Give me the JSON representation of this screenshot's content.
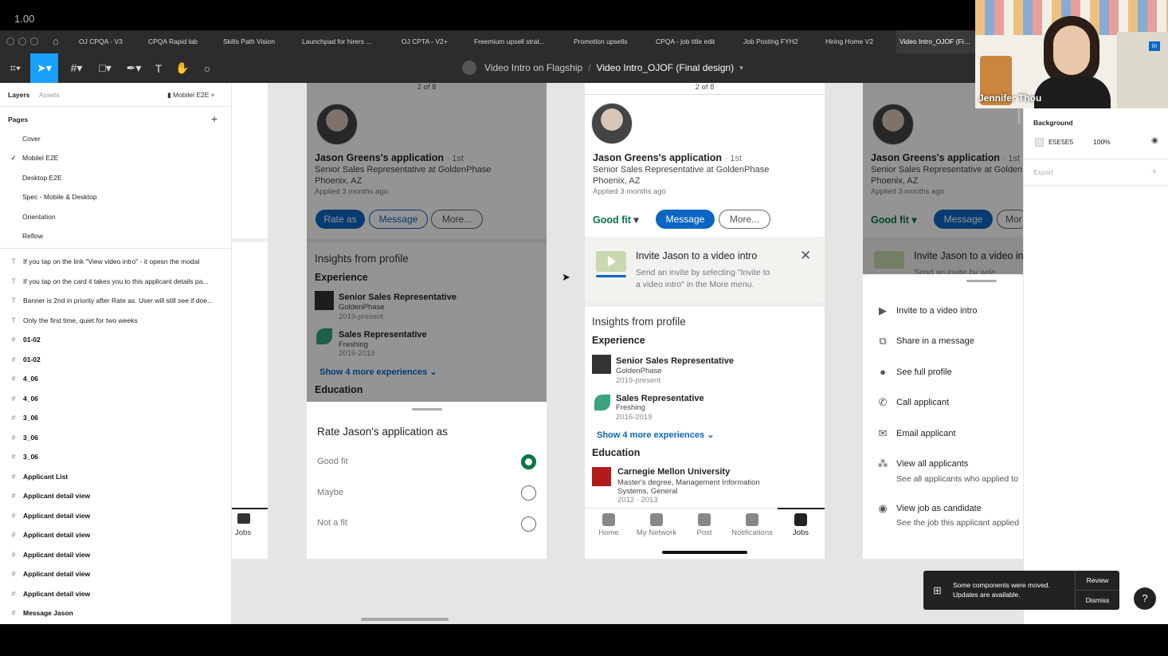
{
  "zoom": "1.00",
  "tabs": [
    "OJ CPQA - V3",
    "CPQA Rapid lab",
    "Skills Path Vision",
    "Launchpad for hirers ...",
    "OJ CPTA - V2+",
    "Freemium upsell strat...",
    "Promotion upsells",
    "CPQA - job title edit",
    "Job Posting FYH2",
    "Hiring Home V2",
    "Video Intro_OJOF (Fin..."
  ],
  "breadcrumb": {
    "project": "Video Intro on Flagship",
    "separator": "/",
    "file": "Video Intro_OJOF (Final design)"
  },
  "layers_panel": {
    "tab_layers": "Layers",
    "tab_assets": "Assets",
    "page_selector": "Mobilel E2E",
    "pages_label": "Pages",
    "pages": [
      "Cover",
      "Mobilel E2E",
      "Desktop E2E",
      "Spec - Mobile & Desktop",
      "Orientation",
      "Reflow"
    ],
    "layers": [
      {
        "type": "text",
        "label": "If you tap on the link \"View video intro\" - it opesn the modal"
      },
      {
        "type": "text",
        "label": "If you tap on the card it takes you to this applicant details pa..."
      },
      {
        "type": "text",
        "label": "Banner is 2nd in priority after Rate as. User will still see if doe..."
      },
      {
        "type": "text",
        "label": "Only the first time, quiet for two weeks"
      },
      {
        "type": "frame",
        "label": "01-02"
      },
      {
        "type": "frame",
        "label": "01-02"
      },
      {
        "type": "frame",
        "label": "4_06"
      },
      {
        "type": "frame",
        "label": "4_06"
      },
      {
        "type": "frame",
        "label": "3_06"
      },
      {
        "type": "frame",
        "label": "3_06"
      },
      {
        "type": "frame",
        "label": "3_06"
      },
      {
        "type": "frame",
        "label": "Applicant List"
      },
      {
        "type": "frame",
        "label": "Applicant detail view"
      },
      {
        "type": "frame",
        "label": "Applicant detail view"
      },
      {
        "type": "frame",
        "label": "Applicant detail view"
      },
      {
        "type": "frame",
        "label": "Applicant detail view"
      },
      {
        "type": "frame",
        "label": "Applicant detail view"
      },
      {
        "type": "frame",
        "label": "Applicant detail view"
      },
      {
        "type": "frame",
        "label": "Message Jason"
      }
    ]
  },
  "right_panel": {
    "background_label": "Background",
    "bg_hex": "E5E5E5",
    "bg_opacity": "100%",
    "export_label": "Export"
  },
  "video": {
    "name": "Jennifer Thou"
  },
  "applicant": {
    "counter": "2 of 8",
    "name": "Jason Greens's application",
    "degree": "· 1st",
    "headline": "Senior Sales Representative at GoldenPhase",
    "location": "Phoenix, AZ",
    "applied": "Applied 3 months ago",
    "rate_as": "Rate as",
    "good_fit": "Good fit",
    "message": "Message",
    "more": "More...",
    "more_short": "Mor",
    "insights": "Insights from profile",
    "experience": "Experience",
    "exp1_title": "Senior Sales Representative",
    "exp1_company": "GoldenPhase",
    "exp1_dates": "2019-present",
    "exp2_title": "Sales Representative",
    "exp2_company": "Freshing",
    "exp2_dates": "2016-2019",
    "show_more": "Show 4 more experiences",
    "education": "Education",
    "edu_school": "Carnegie Mellon University",
    "edu_degree_1": "Master's degree, Management Information",
    "edu_degree_2": "Systems, General",
    "edu_dates": "2012 - 2013"
  },
  "invite_banner": {
    "title": "Invite Jason to a video intro",
    "title_short": "Invite Jason to a video in",
    "body_1": "Send an invite by selecting \"Invite to",
    "body_2": "a video intro\" in the More menu.",
    "body_short": "Send an invite by sele"
  },
  "rate_sheet": {
    "title": "Rate Jason's application as",
    "options": [
      {
        "label": "Good fit",
        "selected": true
      },
      {
        "label": "Maybe",
        "selected": false
      },
      {
        "label": "Not a fit",
        "selected": false
      }
    ]
  },
  "more_menu": {
    "items": [
      {
        "icon": "video-icon",
        "label": "Invite to a video intro",
        "sub": ""
      },
      {
        "icon": "share-icon",
        "label": "Share in a message",
        "sub": ""
      },
      {
        "icon": "person-icon",
        "label": "See full profile",
        "sub": ""
      },
      {
        "icon": "phone-icon",
        "label": "Call applicant",
        "sub": ""
      },
      {
        "icon": "email-icon",
        "label": "Email applicant",
        "sub": ""
      },
      {
        "icon": "people-icon",
        "label": "View all applicants",
        "sub": "See all applicants who applied to"
      },
      {
        "icon": "eye-icon",
        "label": "View job as candidate",
        "sub": "See the job this applicant applied"
      }
    ]
  },
  "bottom_nav": [
    "Home",
    "My Network",
    "Post",
    "Notifications",
    "Jobs"
  ],
  "toast": {
    "line1": "Some components were moved.",
    "line2": "Updates are available.",
    "review": "Review",
    "dismiss": "Dismiss"
  },
  "help": "?",
  "colors": {
    "linkedin_blue": "#0a66c2",
    "good_fit_green": "#057642",
    "canvas_bg": "#E5E5E5"
  }
}
